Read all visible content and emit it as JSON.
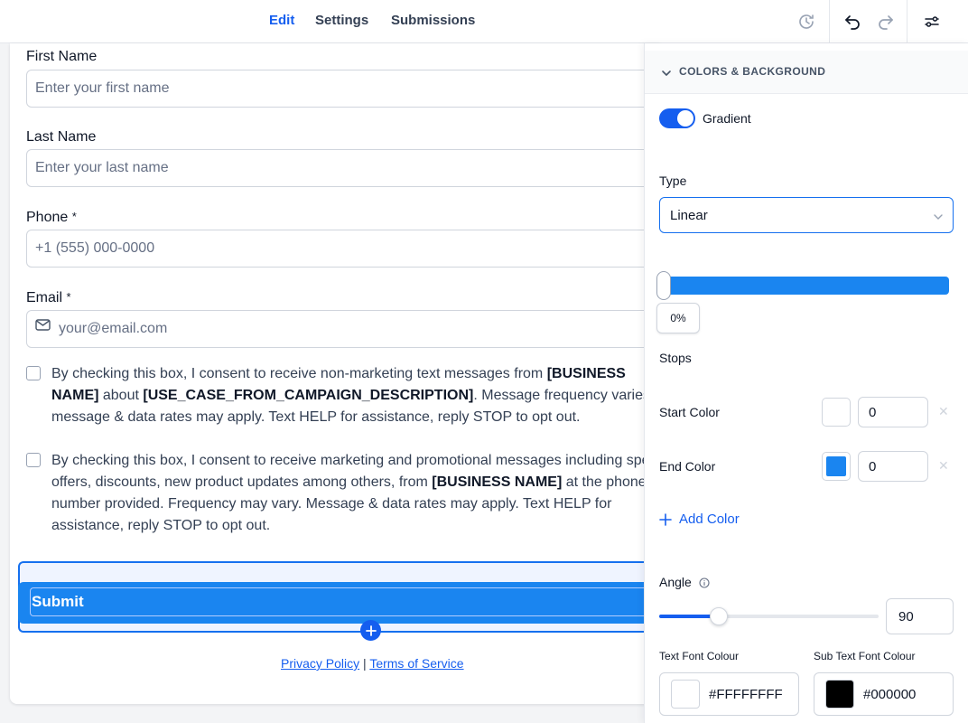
{
  "tabs": [
    {
      "label": "Edit",
      "active": true
    },
    {
      "label": "Settings",
      "active": false
    },
    {
      "label": "Submissions",
      "active": false
    }
  ],
  "toolbar_icons": [
    "history-icon",
    "undo-icon",
    "redo-icon",
    "sliders-icon"
  ],
  "form": {
    "first_name": {
      "label": "First Name",
      "placeholder": "Enter your first name"
    },
    "last_name": {
      "label": "Last Name",
      "placeholder": "Enter your last name"
    },
    "phone": {
      "label": "Phone",
      "required": "*",
      "placeholder": "+1 (555) 000-0000"
    },
    "email": {
      "label": "Email",
      "required": "*",
      "placeholder": "your@email.com"
    },
    "consent1": {
      "p1": "By checking this box, I consent to receive non-marketing text messages from ",
      "b1": "[BUSINESS NAME]",
      "p2": " about ",
      "b2": "[USE_CASE_FROM_CAMPAIGN_DESCRIPTION]",
      "p3": ". Message frequency varies, message & data rates may apply. Text HELP for assistance, reply STOP to opt out."
    },
    "consent2": {
      "p1": "By checking this box, I consent to receive marketing and promotional messages including special offers, discounts, new product updates among others, from ",
      "b1": "[BUSINESS NAME]",
      "p2": " at the phone number provided. Frequency may vary. Message & data rates may apply. Text HELP for assistance, reply STOP to opt out."
    },
    "submit_label": "Submit",
    "privacy_link": "Privacy Policy",
    "separator": "|",
    "terms_link": "Terms of Service"
  },
  "panel": {
    "section_title": "COLORS & BACKGROUND",
    "gradient_label": "Gradient",
    "gradient_enabled": true,
    "type_label": "Type",
    "type_value": "Linear",
    "stop_position": "0%",
    "stops_label": "Stops",
    "start_color": {
      "label": "Start Color",
      "value": "0",
      "color": "#FFFFFF"
    },
    "end_color": {
      "label": "End Color",
      "value": "0",
      "color": "#1A85F0"
    },
    "remove_glyph": "✕",
    "add_color_label": "Add Color",
    "angle_label": "Angle",
    "angle_value": "90",
    "angle_fraction": 0.27,
    "text_font_colour": {
      "label": "Text Font Colour",
      "value": "#FFFFFFFF",
      "color": "#FFFFFF"
    },
    "sub_text_font_colour": {
      "label": "Sub Text Font Colour",
      "value": "#000000",
      "color": "#000000"
    }
  },
  "colors": {
    "accent": "#155EEF",
    "brand_blue": "#1A85F0"
  }
}
